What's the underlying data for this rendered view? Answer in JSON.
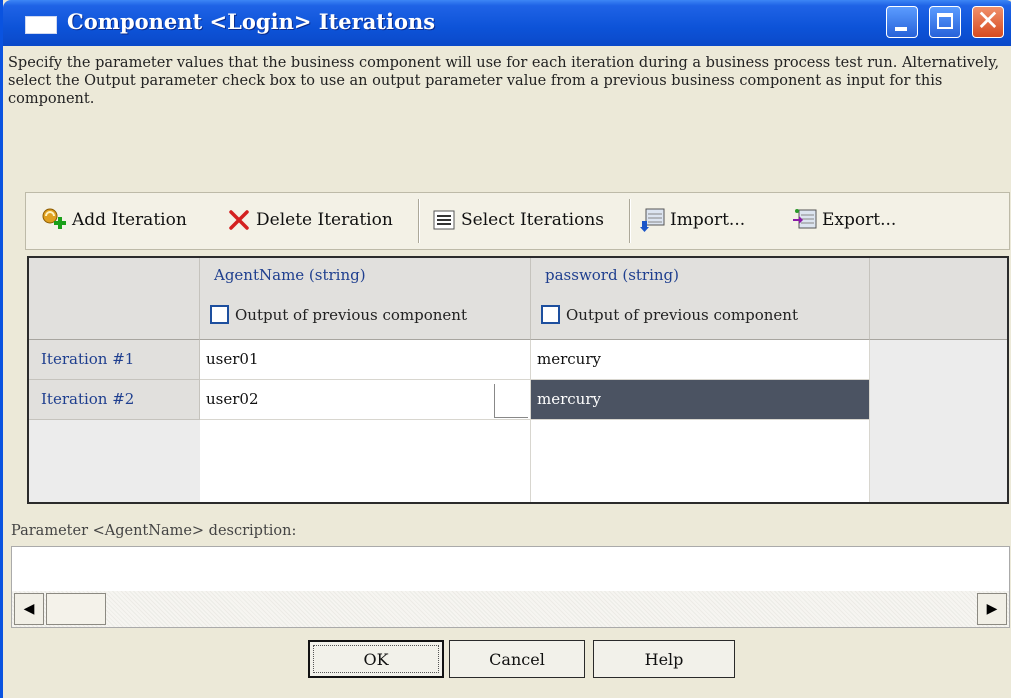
{
  "window": {
    "title": "Component <Login> Iterations",
    "controls": {
      "minimize": "minimize",
      "maximize": "maximize",
      "close": "✕"
    }
  },
  "description": "Specify the parameter values that the business component will use for each iteration during a business process test run. Alternatively, select the Output parameter check box to use an output parameter value from a previous business component as input for this component.",
  "toolbar": {
    "add_label": "Add Iteration",
    "delete_label": "Delete Iteration",
    "select_label": "Select Iterations",
    "import_label": "Import...",
    "export_label": "Export..."
  },
  "grid": {
    "columns": [
      {
        "header": "AgentName (string)",
        "checkbox_label": "Output of previous component",
        "checked": false
      },
      {
        "header": "password (string)",
        "checkbox_label": "Output of previous component",
        "checked": false
      }
    ],
    "rows": [
      {
        "label": "Iteration #1",
        "values": [
          "user01",
          "mercury"
        ]
      },
      {
        "label": "Iteration #2",
        "values": [
          "user02",
          "mercury"
        ]
      }
    ]
  },
  "param_description": {
    "label": "Parameter <AgentName> description:",
    "value": ""
  },
  "buttons": {
    "ok": "OK",
    "cancel": "Cancel",
    "help": "Help"
  },
  "colors": {
    "titlebar": "#0a53e0",
    "selected_cell": "#4b5362",
    "header_text": "#1f3f8f"
  }
}
